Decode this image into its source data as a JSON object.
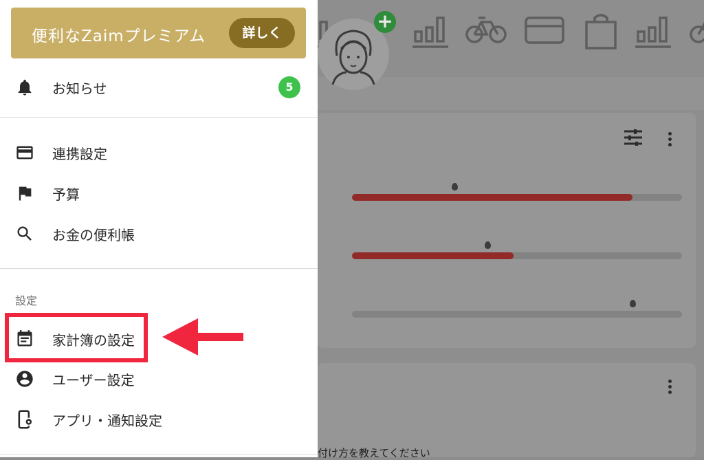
{
  "drawer": {
    "premium": {
      "title": "便利なZaimプレミアム",
      "button_label": "詳しく",
      "bg_color": "#c9af66",
      "button_color": "#876d23"
    },
    "notifications": {
      "label": "お知らせ",
      "icon": "bell-icon",
      "badge_count": "5",
      "badge_color": "#3ec24c"
    },
    "main_items": [
      {
        "label": "連携設定",
        "icon": "credit-card-icon"
      },
      {
        "label": "予算",
        "icon": "flag-icon"
      },
      {
        "label": "お金の便利帳",
        "icon": "search-icon"
      }
    ],
    "settings_section": {
      "header": "設定",
      "items": [
        {
          "label": "家計簿の設定",
          "icon": "calendar-icon",
          "highlighted": true
        },
        {
          "label": "ユーザー設定",
          "icon": "account-circle-icon"
        },
        {
          "label": "アプリ・通知設定",
          "icon": "phone-settings-icon"
        }
      ]
    }
  },
  "annotation": {
    "highlight_color": "#f0263f",
    "arrow_target": "家計簿の設定"
  },
  "background": {
    "category_icons": [
      "chart-icon",
      "bicycle-icon",
      "card-icon",
      "shopping-bag-icon",
      "chart-icon",
      "bicycle-icon"
    ],
    "budget_bars": [
      {
        "fill_fraction": 0.85,
        "marker_fraction": 0.31
      },
      {
        "fill_fraction": 0.49,
        "marker_fraction": 0.41
      },
      {
        "fill_fraction": 0.0,
        "marker_fraction": 0.85
      }
    ],
    "bar_fill_color": "#922a2a",
    "bottom_text": "付け方を教えてください"
  }
}
